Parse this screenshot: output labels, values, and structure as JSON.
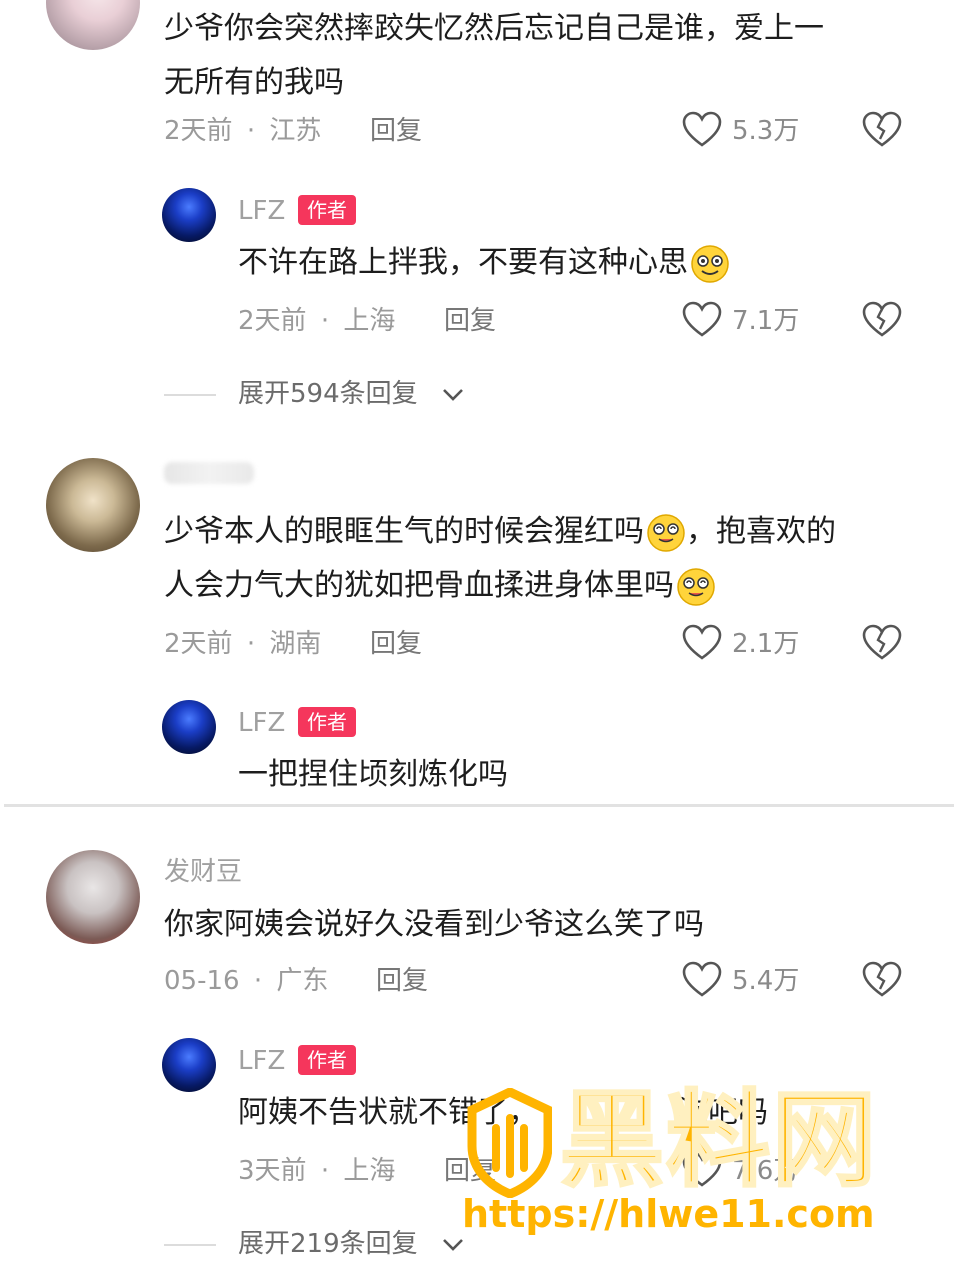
{
  "comments": [
    {
      "text": "少爷你会突然摔跤失忆然后忘记自己是谁，爱上一无所有的我吗",
      "line1": "少爷你会突然摔跤失忆然后忘记自己是谁，爱上一",
      "line2": "无所有的我吗",
      "time": "2天前",
      "location": "江苏",
      "reply_label": "回复",
      "likes": "5.3万",
      "author_reply": {
        "username": "LFZ",
        "badge": "作者",
        "text": "不许在路上拌我，不要有这种心思",
        "time": "2天前",
        "location": "上海",
        "reply_label": "回复",
        "likes": "7.1万"
      },
      "expand": "展开594条回复"
    },
    {
      "text": "少爷本人的眼眶生气的时候会猩红吗，抱喜欢的人会力气大的犹如把骨血揉进身体里吗",
      "line1a": "少爷本人的眼眶生气的时候会猩红吗",
      "line1b": "，抱喜欢的",
      "line2": "人会力气大的犹如把骨血揉进身体里吗",
      "time": "2天前",
      "location": "湖南",
      "reply_label": "回复",
      "likes": "2.1万",
      "author_reply": {
        "username": "LFZ",
        "badge": "作者",
        "text": "一把捏住顷刻炼化吗"
      }
    },
    {
      "username": "发财豆",
      "text": "你家阿姨会说好久没看到少爷这么笑了吗",
      "time": "05-16",
      "location": "广东",
      "reply_label": "回复",
      "likes": "5.4万",
      "author_reply": {
        "username": "LFZ",
        "badge": "作者",
        "text_a": "阿姨不告状就不错了，",
        "text_b": "泡吧吗",
        "time": "3天前",
        "location": "上海",
        "reply_label": "回复",
        "likes": "7.6万"
      },
      "expand": "展开219条回复"
    }
  ],
  "meta_separator": "·",
  "watermark": {
    "brand": "黑料网",
    "url": "https://hlwe11.com",
    "color": "#ffb400"
  },
  "colors": {
    "badge": "#f5365c",
    "text": "#1d1d1d",
    "meta": "#9a9a9a"
  }
}
